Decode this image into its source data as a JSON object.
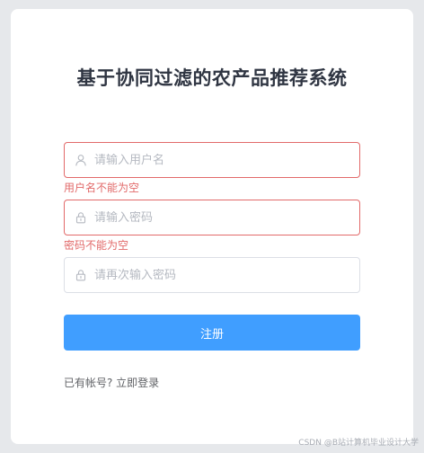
{
  "page": {
    "title": "基于协同过滤的农产品推荐系统"
  },
  "form": {
    "username": {
      "placeholder": "请输入用户名",
      "value": "",
      "error": "用户名不能为空"
    },
    "password": {
      "placeholder": "请输入密码",
      "value": "",
      "error": "密码不能为空"
    },
    "confirm_password": {
      "placeholder": "请再次输入密码",
      "value": ""
    },
    "register_label": "注册",
    "login_link": "已有帐号? 立即登录"
  },
  "watermark": "CSDN @B站计算机毕业设计大学",
  "icons": {
    "username": "user-icon",
    "password": "lock-icon",
    "confirm_password": "lock-icon"
  },
  "colors": {
    "accent": "#409eff",
    "error": "#e26a6a",
    "title": "#2f3542"
  }
}
